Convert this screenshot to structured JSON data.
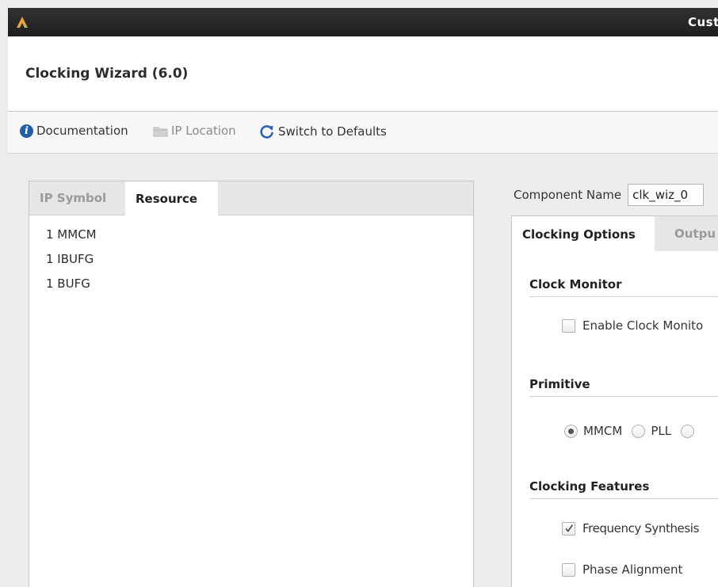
{
  "window": {
    "title": "Cust",
    "logo": "vivado-logo-icon"
  },
  "header": {
    "heading": "Clocking Wizard (6.0)"
  },
  "toolbar": {
    "documentation": {
      "label": "Documentation",
      "icon": "info-icon"
    },
    "ip_location": {
      "label": "IP Location",
      "icon": "folder-icon"
    },
    "switch_defaults": {
      "label": "Switch to Defaults",
      "icon": "refresh-icon"
    }
  },
  "left_panel": {
    "tabs": [
      {
        "label": "IP Symbol",
        "active": false
      },
      {
        "label": "Resource",
        "active": true
      }
    ],
    "resources": [
      "1 MMCM",
      "1 IBUFG",
      "1 BUFG"
    ]
  },
  "component": {
    "label": "Component Name",
    "value": "clk_wiz_0"
  },
  "right_panel": {
    "tabs": [
      {
        "label": "Clocking Options",
        "active": true
      },
      {
        "label": "Outpu",
        "active": false
      }
    ],
    "clock_monitor": {
      "heading": "Clock Monitor",
      "enable": {
        "label": "Enable Clock Monito",
        "checked": false
      }
    },
    "primitive": {
      "heading": "Primitive",
      "options": [
        {
          "label": "MMCM",
          "selected": true
        },
        {
          "label": "PLL",
          "selected": false
        },
        {
          "label": "",
          "selected": false
        }
      ]
    },
    "clocking_features": {
      "heading": "Clocking Features",
      "frequency_synthesis": {
        "label": "Frequency Synthesis",
        "checked": true
      },
      "phase_alignment": {
        "label": "Phase Alignment",
        "checked": false
      }
    }
  },
  "colors": {
    "titlebar": "#262626",
    "logo": "#e8a33c",
    "info_blue": "#1f5fa8",
    "refresh_blue": "#2a62b4"
  }
}
